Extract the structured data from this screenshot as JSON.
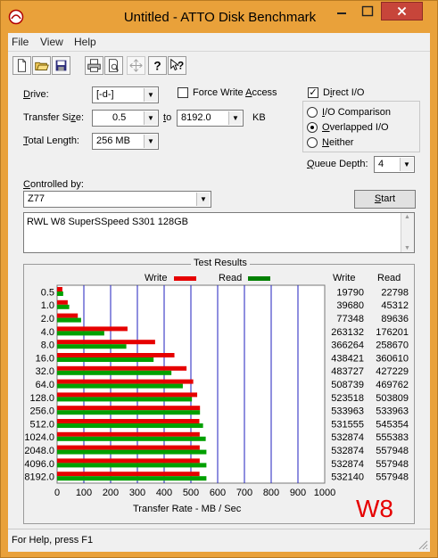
{
  "window": {
    "title": "Untitled - ATTO Disk Benchmark",
    "title_bar_color": "#e9a13a"
  },
  "menu": [
    "File",
    "View",
    "Help"
  ],
  "toolbar": {
    "icons": [
      "new-file-icon",
      "open-folder-icon",
      "save-icon",
      "print-icon",
      "print-preview-icon",
      "move-icon",
      "help-icon",
      "context-help-icon"
    ]
  },
  "settings": {
    "drive_label": "Drive:",
    "drive_value": "[-d-]",
    "force_write_label": "Force Write Access",
    "force_write_checked": false,
    "direct_io_label": "Direct I/O",
    "direct_io_checked": true,
    "transfer_size_label": "Transfer Size:",
    "transfer_from": "0.5",
    "to_label": "to",
    "transfer_to": "8192.0",
    "kb_label": "KB",
    "total_length_label": "Total Length:",
    "total_length_value": "256 MB",
    "io_comparison_label": "I/O Comparison",
    "overlapped_io_label": "Overlapped I/O",
    "neither_label": "Neither",
    "selected_mode": "Overlapped I/O",
    "queue_depth_label": "Queue Depth:",
    "queue_depth_value": "4",
    "controlled_by_label": "Controlled by:",
    "controlled_by_value": "Z77",
    "start_label": "Start",
    "description": "RWL W8 SuperSSpeed S301 128GB"
  },
  "chart_data": {
    "type": "bar",
    "title": "Test Results",
    "xlabel": "Transfer Rate - MB / Sec",
    "x_ticks": [
      "0",
      "100",
      "200",
      "300",
      "400",
      "500",
      "600",
      "700",
      "800",
      "900",
      "1000"
    ],
    "xlim": [
      0,
      1000
    ],
    "grid": true,
    "legend_position": "top",
    "categories": [
      "0.5",
      "1.0",
      "2.0",
      "4.0",
      "8.0",
      "16.0",
      "32.0",
      "64.0",
      "128.0",
      "256.0",
      "512.0",
      "1024.0",
      "2048.0",
      "4096.0",
      "8192.0"
    ],
    "series": [
      {
        "name": "Write",
        "color": "#e60000",
        "values": [
          19790,
          39680,
          77348,
          263132,
          366264,
          438421,
          483727,
          508739,
          523518,
          533963,
          531555,
          532874,
          532874,
          532874,
          532140
        ]
      },
      {
        "name": "Read",
        "color": "#00a000",
        "values": [
          22798,
          45312,
          89636,
          176201,
          258670,
          360610,
          427229,
          469762,
          503809,
          533963,
          545354,
          555383,
          557948,
          557948,
          557948
        ]
      }
    ],
    "columns": [
      "Write",
      "Read"
    ],
    "bar_value_divisor": 1000,
    "annotation": "W8",
    "annotation_color": "#e60000",
    "grid_color": "#1f1fbf"
  },
  "status": {
    "text": "For Help, press F1"
  }
}
